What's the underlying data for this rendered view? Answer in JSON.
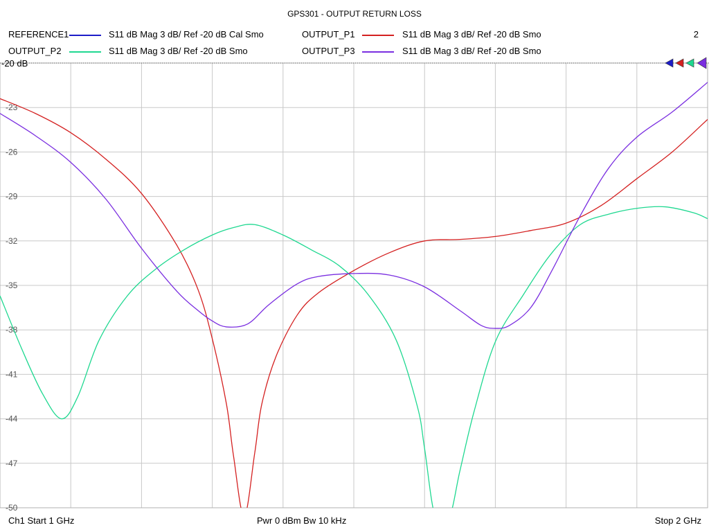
{
  "chart_data": {
    "type": "line",
    "title": "GPS301 - OUTPUT RETURN LOSS",
    "channel_number": "2",
    "reference_label": "-20 dB",
    "xlim": [
      1,
      2
    ],
    "ylim": [
      -50,
      -20
    ],
    "x_ticks": [
      1.0,
      1.1,
      1.2,
      1.3,
      1.4,
      1.5,
      1.6,
      1.7,
      1.8,
      1.9,
      2.0
    ],
    "y_ticks": [
      -20,
      -23,
      -26,
      -29,
      -32,
      -35,
      -38,
      -41,
      -44,
      -47,
      -50
    ],
    "y_tick_labels": [
      "-20",
      "-23",
      "-26",
      "-29",
      "-32",
      "-35",
      "-38",
      "-41",
      "-44",
      "-47",
      "-50"
    ],
    "grid": true,
    "footer": {
      "start": "Ch1  Start  1 GHz",
      "power": "Pwr  0 dBm  Bw  10 kHz",
      "stop": "Stop  2 GHz"
    },
    "series": [
      {
        "name": "REFERENCE1",
        "desc": "S11  dB Mag  3 dB/ Ref -20 dB  Cal Smo",
        "color": "#1c1cc8",
        "x": [],
        "y": []
      },
      {
        "name": "OUTPUT_P1",
        "desc": "S11  dB Mag  3 dB/ Ref -20 dB  Smo",
        "color": "#d42020",
        "x": [
          1.0,
          1.05,
          1.1,
          1.15,
          1.2,
          1.25,
          1.28,
          1.3,
          1.32,
          1.33,
          1.345,
          1.36,
          1.37,
          1.39,
          1.42,
          1.45,
          1.5,
          1.55,
          1.6,
          1.65,
          1.7,
          1.75,
          1.8,
          1.85,
          1.9,
          1.95,
          2.0
        ],
        "y": [
          -22.4,
          -23.4,
          -24.7,
          -26.5,
          -28.8,
          -32.3,
          -35.3,
          -38.6,
          -43.0,
          -46.5,
          -50.6,
          -46.3,
          -43.0,
          -39.8,
          -37.0,
          -35.5,
          -34.0,
          -32.8,
          -32.0,
          -31.9,
          -31.7,
          -31.3,
          -30.8,
          -29.6,
          -27.8,
          -26.0,
          -23.8
        ]
      },
      {
        "name": "OUTPUT_P2",
        "desc": "S11  dB Mag  3 dB/ Ref -20 dB  Smo",
        "color": "#1ed890",
        "x": [
          1.0,
          1.03,
          1.06,
          1.087,
          1.11,
          1.14,
          1.18,
          1.22,
          1.26,
          1.3,
          1.33,
          1.36,
          1.4,
          1.44,
          1.48,
          1.52,
          1.56,
          1.59,
          1.6,
          1.615,
          1.635,
          1.65,
          1.67,
          1.7,
          1.74,
          1.78,
          1.82,
          1.86,
          1.9,
          1.94,
          1.98,
          2.0
        ],
        "y": [
          -35.7,
          -39.2,
          -42.3,
          -44.0,
          -42.5,
          -38.7,
          -35.7,
          -33.9,
          -32.6,
          -31.6,
          -31.1,
          -30.9,
          -31.6,
          -32.6,
          -33.7,
          -35.6,
          -38.7,
          -43.2,
          -46.0,
          -50.6,
          -50.6,
          -47.5,
          -43.5,
          -38.8,
          -35.6,
          -32.8,
          -30.9,
          -30.2,
          -29.8,
          -29.7,
          -30.1,
          -30.5
        ]
      },
      {
        "name": "OUTPUT_P3",
        "desc": "S11  dB Mag  3 dB/ Ref -20 dB  Smo",
        "color": "#7a2ee0",
        "x": [
          1.0,
          1.05,
          1.1,
          1.15,
          1.2,
          1.25,
          1.28,
          1.3,
          1.32,
          1.35,
          1.38,
          1.42,
          1.45,
          1.5,
          1.55,
          1.6,
          1.65,
          1.68,
          1.7,
          1.72,
          1.75,
          1.78,
          1.82,
          1.86,
          1.9,
          1.95,
          2.0
        ],
        "y": [
          -23.4,
          -24.9,
          -26.7,
          -29.2,
          -32.5,
          -35.4,
          -36.7,
          -37.4,
          -37.8,
          -37.6,
          -36.3,
          -34.9,
          -34.4,
          -34.2,
          -34.3,
          -35.1,
          -36.7,
          -37.7,
          -37.9,
          -37.7,
          -36.5,
          -34.0,
          -30.3,
          -27.1,
          -25.0,
          -23.3,
          -21.3
        ]
      }
    ]
  }
}
